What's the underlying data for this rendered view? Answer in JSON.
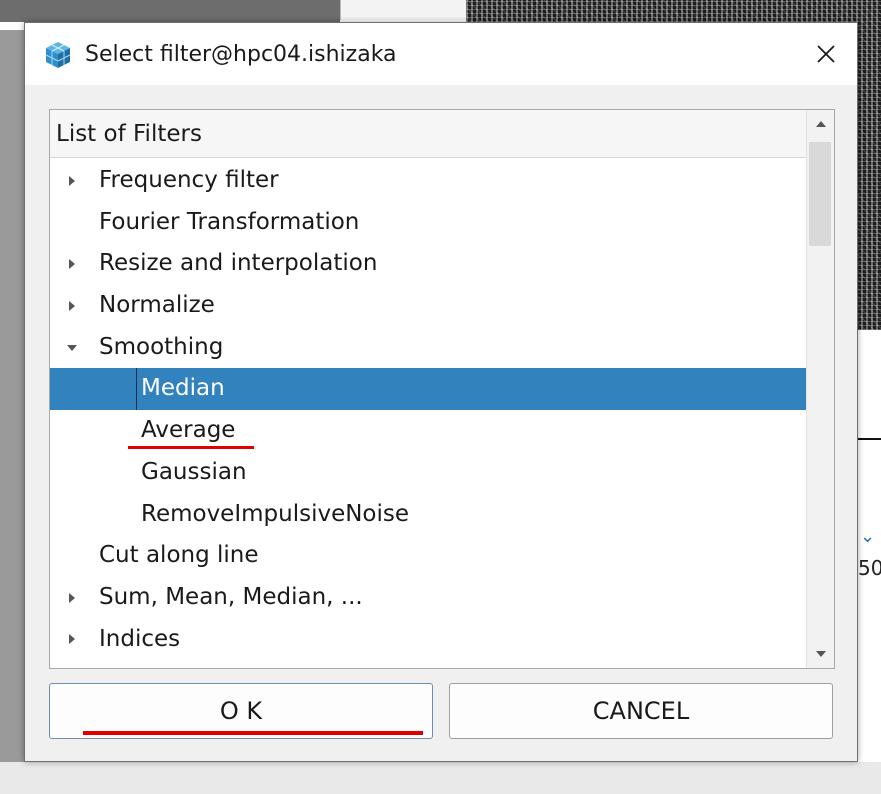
{
  "dialog": {
    "title": "Select filter@hpc04.ishizaka",
    "app_icon": "cube-icon",
    "close_icon": "close-icon"
  },
  "tree": {
    "header": "List of Filters",
    "items": [
      {
        "label": "Frequency filter",
        "level": 0,
        "expander": "collapsed"
      },
      {
        "label": "Fourier Transformation",
        "level": 0,
        "expander": "none"
      },
      {
        "label": "Resize and interpolation",
        "level": 0,
        "expander": "collapsed"
      },
      {
        "label": "Normalize",
        "level": 0,
        "expander": "collapsed"
      },
      {
        "label": "Smoothing",
        "level": 0,
        "expander": "expanded"
      },
      {
        "label": "Median",
        "level": 1,
        "expander": "none",
        "selected": true
      },
      {
        "label": "Average",
        "level": 1,
        "expander": "none"
      },
      {
        "label": "Gaussian",
        "level": 1,
        "expander": "none"
      },
      {
        "label": "RemoveImpulsiveNoise",
        "level": 1,
        "expander": "none"
      },
      {
        "label": "Cut along line",
        "level": 0,
        "expander": "none"
      },
      {
        "label": "Sum, Mean, Median, ...",
        "level": 0,
        "expander": "collapsed"
      },
      {
        "label": "Indices",
        "level": 0,
        "expander": "collapsed"
      }
    ]
  },
  "buttons": {
    "ok": "O K",
    "cancel": "CANCEL"
  },
  "background": {
    "right_fragment": "50"
  },
  "colors": {
    "selection": "#3182bd",
    "highlight_underline": "#e00000"
  }
}
